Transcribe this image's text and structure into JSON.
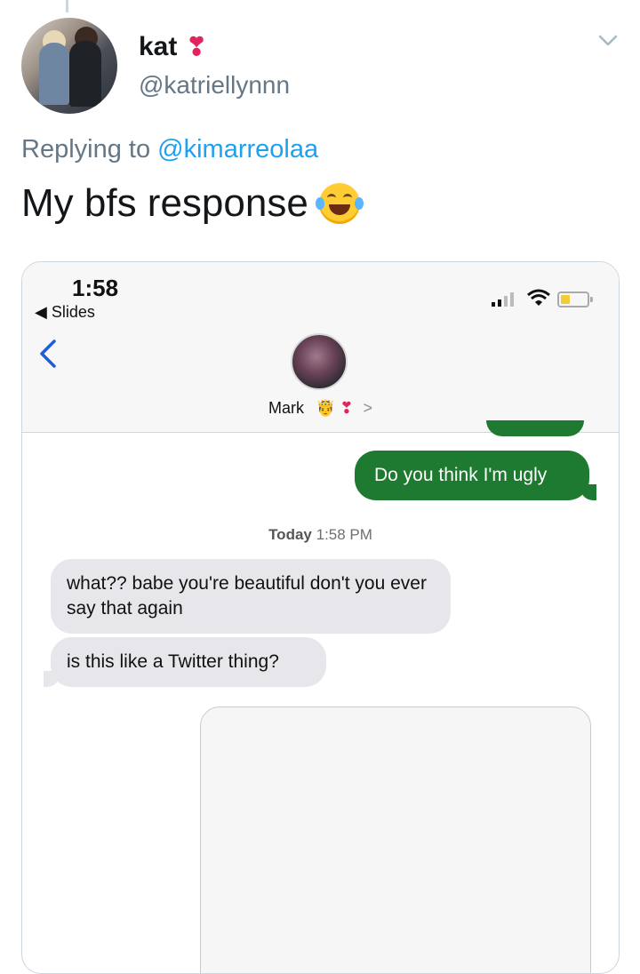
{
  "tweet": {
    "display_name": "kat",
    "name_emoji": "❣",
    "handle": "@katriellynnn",
    "replying_prefix": "Replying to",
    "replying_to": "@kimarreolaa",
    "text": "My bfs response",
    "text_emoji": "laughing-with-tears-emoji",
    "accent_color": "#1da1f2"
  },
  "screenshot": {
    "status_bar": {
      "time": "1:58",
      "back_app": "Slides"
    },
    "contact": {
      "name": "Mark",
      "emoji_1": "🤴",
      "emoji_2": "❣",
      "chevron": ">"
    },
    "messages": [
      {
        "from": "me",
        "text": "Do you think I'm ugly"
      },
      {
        "from": "them",
        "text": "what?? babe you're beautiful don't you ever say that again"
      },
      {
        "from": "them",
        "text": "is this like a Twitter thing?"
      }
    ],
    "timestamp_day": "Today",
    "timestamp_time": "1:58 PM",
    "sent_bubble_color": "#1f7a31",
    "received_bubble_color": "#e6e6eb"
  }
}
